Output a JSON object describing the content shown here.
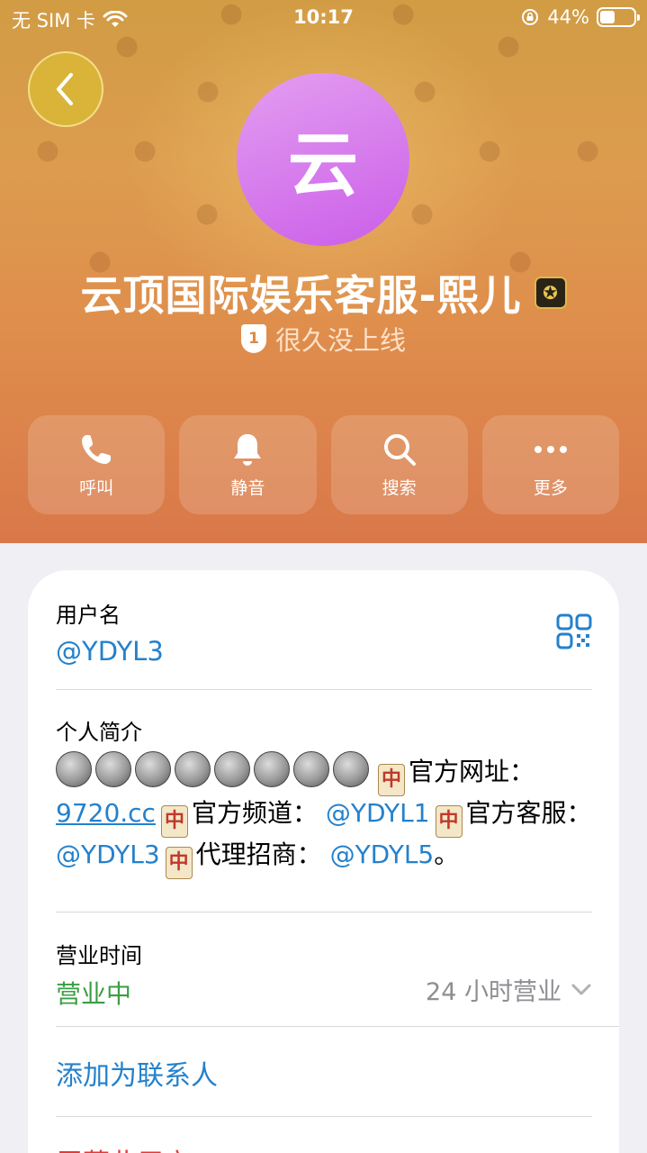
{
  "status_bar": {
    "carrier": "无 SIM 卡",
    "time": "10:17",
    "battery": "44%",
    "battery_level": 0.44
  },
  "header": {
    "avatar_letter": "云",
    "name": "云顶国际娱乐客服-熙儿",
    "last_seen": "很久没上线",
    "shield_number": "1"
  },
  "actions": [
    {
      "label": "呼叫",
      "icon": "phone-icon"
    },
    {
      "label": "静音",
      "icon": "bell-icon"
    },
    {
      "label": "搜索",
      "icon": "search-icon"
    },
    {
      "label": "更多",
      "icon": "more-icon"
    }
  ],
  "info": {
    "username_label": "用户名",
    "username_value": "@YDYL3",
    "bio_label": "个人简介",
    "bio": {
      "site_label": "官方网址：",
      "site_link": "9720.cc",
      "channel_label": "官方频道：",
      "channel_link": "@YDYL1",
      "service_label": "官方客服：",
      "service_link": "@YDYL3",
      "agent_label": "代理招商：",
      "agent_link": "@YDYL5",
      "end": "。",
      "tile_char": "中"
    },
    "hours_label": "营业时间",
    "hours_status": "营业中",
    "hours_detail": "24 小时营业",
    "add_contact": "添加为联系人",
    "partial_row": "屏蔽此用户"
  }
}
